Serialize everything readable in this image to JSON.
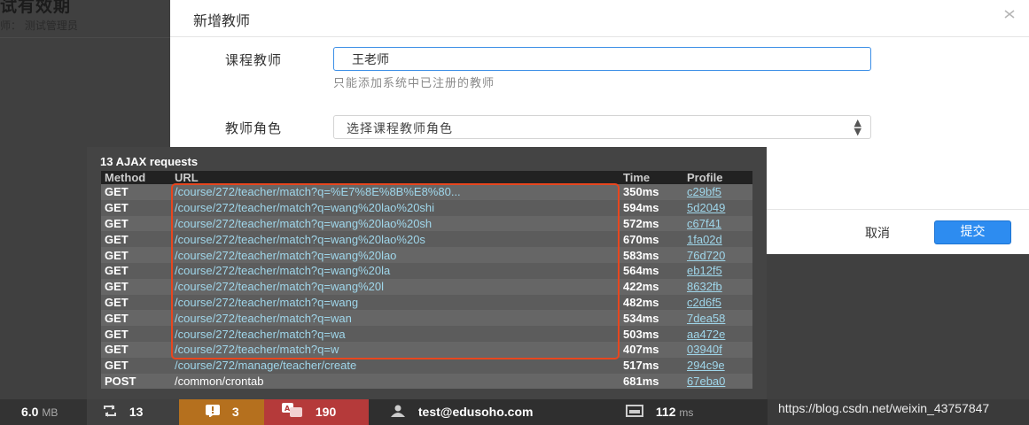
{
  "background": {
    "title": "试有效期",
    "subtitle": "师：  测试管理员"
  },
  "modal": {
    "title": "新增教师",
    "close_icon": "close-icon",
    "teacher_label": "课程教师",
    "teacher_value": "王老师",
    "teacher_help": "只能添加系统中已注册的教师",
    "role_label": "教师角色",
    "role_value": "选择课程教师角色",
    "cancel_label": "取消",
    "submit_label": "提交",
    "colors": {
      "primary": "#2d8cf0",
      "input_focus": "#3b8ee6"
    }
  },
  "ajax_panel": {
    "title": "13 AJAX requests",
    "columns": [
      "Method",
      "URL",
      "Time",
      "Profile"
    ],
    "rows": [
      {
        "method": "GET",
        "url": "/course/272/teacher/match?q=%E7%8E%8B%E8%80...",
        "time": "350ms",
        "profile": "c29bf5"
      },
      {
        "method": "GET",
        "url": "/course/272/teacher/match?q=wang%20lao%20shi",
        "time": "594ms",
        "profile": "5d2049"
      },
      {
        "method": "GET",
        "url": "/course/272/teacher/match?q=wang%20lao%20sh",
        "time": "572ms",
        "profile": "c67f41"
      },
      {
        "method": "GET",
        "url": "/course/272/teacher/match?q=wang%20lao%20s",
        "time": "670ms",
        "profile": "1fa02d"
      },
      {
        "method": "GET",
        "url": "/course/272/teacher/match?q=wang%20lao",
        "time": "583ms",
        "profile": "76d720"
      },
      {
        "method": "GET",
        "url": "/course/272/teacher/match?q=wang%20la",
        "time": "564ms",
        "profile": "eb12f5"
      },
      {
        "method": "GET",
        "url": "/course/272/teacher/match?q=wang%20l",
        "time": "422ms",
        "profile": "8632fb"
      },
      {
        "method": "GET",
        "url": "/course/272/teacher/match?q=wang",
        "time": "482ms",
        "profile": "c2d6f5"
      },
      {
        "method": "GET",
        "url": "/course/272/teacher/match?q=wan",
        "time": "534ms",
        "profile": "7dea58"
      },
      {
        "method": "GET",
        "url": "/course/272/teacher/match?q=wa",
        "time": "503ms",
        "profile": "aa472e"
      },
      {
        "method": "GET",
        "url": "/course/272/teacher/match?q=w",
        "time": "407ms",
        "profile": "03940f"
      },
      {
        "method": "GET",
        "url": "/course/272/manage/teacher/create",
        "time": "517ms",
        "profile": "294c9e"
      },
      {
        "method": "POST",
        "url": "/common/crontab",
        "time": "681ms",
        "profile": "67eba0",
        "plain": true
      }
    ],
    "highlight_color": "#e8461e"
  },
  "toolbar": {
    "memory_value": "6.0",
    "memory_unit": "MB",
    "ajax_count": "13",
    "errors_count": "3",
    "translations_count": "190",
    "user": "test@edusoho.com",
    "time_value": "112",
    "time_unit": "ms",
    "colors": {
      "errors": "#b5701e",
      "translations": "#b53a3a"
    }
  },
  "watermark": "https://blog.csdn.net/weixin_43757847"
}
